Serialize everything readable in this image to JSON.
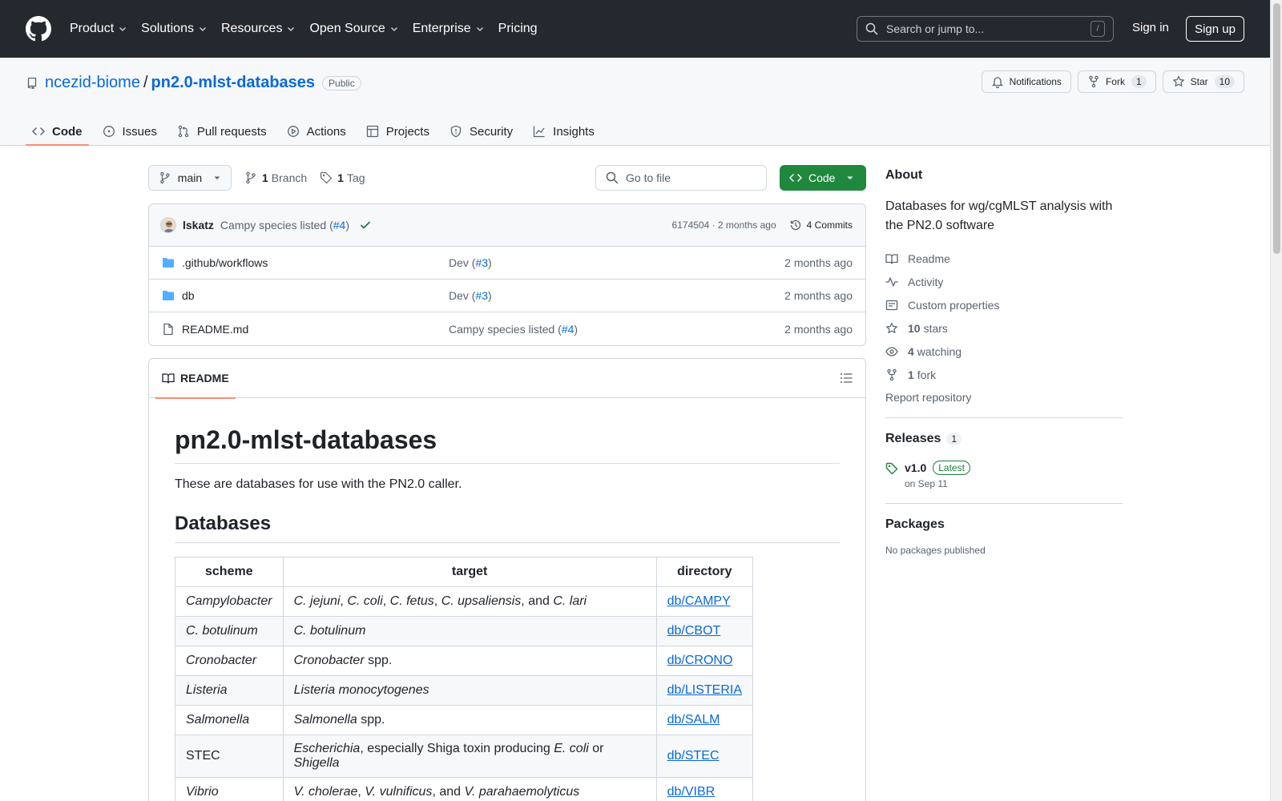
{
  "header": {
    "nav": [
      {
        "label": "Product",
        "dropdown": true
      },
      {
        "label": "Solutions",
        "dropdown": true
      },
      {
        "label": "Resources",
        "dropdown": true
      },
      {
        "label": "Open Source",
        "dropdown": true
      },
      {
        "label": "Enterprise",
        "dropdown": true
      },
      {
        "label": "Pricing",
        "dropdown": false
      }
    ],
    "search_placeholder": "Search or jump to...",
    "search_shortcut": "/",
    "sign_in": "Sign in",
    "sign_up": "Sign up"
  },
  "repo": {
    "owner": "ncezid-biome",
    "separator": "/",
    "name": "pn2.0-mlst-databases",
    "visibility": "Public",
    "notifications_label": "Notifications",
    "fork_label": "Fork",
    "fork_count": "1",
    "star_label": "Star",
    "star_count": "10",
    "tabs": [
      {
        "label": "Code",
        "icon": "code-icon",
        "active": true
      },
      {
        "label": "Issues",
        "icon": "issue-icon",
        "active": false
      },
      {
        "label": "Pull requests",
        "icon": "pull-request-icon",
        "active": false
      },
      {
        "label": "Actions",
        "icon": "play-icon",
        "active": false
      },
      {
        "label": "Projects",
        "icon": "table-icon",
        "active": false
      },
      {
        "label": "Security",
        "icon": "shield-icon",
        "active": false
      },
      {
        "label": "Insights",
        "icon": "graph-icon",
        "active": false
      }
    ]
  },
  "filebar": {
    "branch": "main",
    "branch_count": "1",
    "branch_label": "Branch",
    "tag_count": "1",
    "tag_label": "Tag",
    "goto_placeholder": "Go to file",
    "code_button": "Code"
  },
  "commit": {
    "author": "lskatz",
    "message": "Campy species listed (",
    "pr": "#4",
    "close": ")",
    "sha_time": "6174504 · 2 months ago",
    "commits_label": "4 Commits"
  },
  "files": [
    {
      "name": ".github/workflows",
      "type": "folder",
      "msg": "Dev (",
      "pr": "#3",
      "close": ")",
      "age": "2 months ago"
    },
    {
      "name": "db",
      "type": "folder",
      "msg": "Dev (",
      "pr": "#3",
      "close": ")",
      "age": "2 months ago"
    },
    {
      "name": "README.md",
      "type": "file",
      "msg": "Campy species listed (",
      "pr": "#4",
      "close": ")",
      "age": "2 months ago"
    }
  ],
  "readme": {
    "tab_label": "README",
    "title": "pn2.0-mlst-databases",
    "intro": "These are databases for use with the PN2.0 caller.",
    "section": "Databases",
    "table_headers": [
      "scheme",
      "target",
      "directory"
    ],
    "rows": [
      {
        "scheme": [
          {
            "t": "Campylobacter",
            "i": true
          }
        ],
        "target": [
          {
            "t": "C. jejuni",
            "i": true
          },
          {
            "t": ", ",
            "i": false
          },
          {
            "t": "C. coli",
            "i": true
          },
          {
            "t": ", ",
            "i": false
          },
          {
            "t": "C. fetus",
            "i": true
          },
          {
            "t": ", ",
            "i": false
          },
          {
            "t": "C. upsaliensis",
            "i": true
          },
          {
            "t": ", and ",
            "i": false
          },
          {
            "t": "C. lari",
            "i": true
          }
        ],
        "dir": "db/CAMPY"
      },
      {
        "scheme": [
          {
            "t": "C. botulinum",
            "i": true
          }
        ],
        "target": [
          {
            "t": "C. botulinum",
            "i": true
          }
        ],
        "dir": "db/CBOT"
      },
      {
        "scheme": [
          {
            "t": "Cronobacter",
            "i": true
          }
        ],
        "target": [
          {
            "t": "Cronobacter",
            "i": true
          },
          {
            "t": " spp.",
            "i": false
          }
        ],
        "dir": "db/CRONO"
      },
      {
        "scheme": [
          {
            "t": "Listeria",
            "i": true
          }
        ],
        "target": [
          {
            "t": "Listeria monocytogenes",
            "i": true
          }
        ],
        "dir": "db/LISTERIA"
      },
      {
        "scheme": [
          {
            "t": "Salmonella",
            "i": true
          }
        ],
        "target": [
          {
            "t": "Salmonella",
            "i": true
          },
          {
            "t": " spp.",
            "i": false
          }
        ],
        "dir": "db/SALM"
      },
      {
        "scheme": [
          {
            "t": "STEC",
            "i": false
          }
        ],
        "target": [
          {
            "t": "Escherichia",
            "i": true
          },
          {
            "t": ", especially Shiga toxin producing ",
            "i": false
          },
          {
            "t": "E. coli",
            "i": true
          },
          {
            "t": " or ",
            "i": false
          },
          {
            "t": "Shigella",
            "i": true
          }
        ],
        "dir": "db/STEC"
      },
      {
        "scheme": [
          {
            "t": "Vibrio",
            "i": true
          }
        ],
        "target": [
          {
            "t": "V. cholerae",
            "i": true
          },
          {
            "t": ", ",
            "i": false
          },
          {
            "t": "V. vulnificus",
            "i": true
          },
          {
            "t": ", and ",
            "i": false
          },
          {
            "t": "V. parahaemolyticus",
            "i": true
          }
        ],
        "dir": "db/VIBR"
      }
    ]
  },
  "sidebar": {
    "about_title": "About",
    "description": "Databases for wg/cgMLST analysis with the PN2.0 software",
    "links": [
      {
        "icon": "book-icon",
        "bold": "",
        "label": "Readme"
      },
      {
        "icon": "pulse-icon",
        "bold": "",
        "label": "Activity"
      },
      {
        "icon": "note-icon",
        "bold": "",
        "label": "Custom properties"
      },
      {
        "icon": "star-icon",
        "bold": "10",
        "label": "stars"
      },
      {
        "icon": "eye-icon",
        "bold": "4",
        "label": "watching"
      },
      {
        "icon": "fork-icon",
        "bold": "1",
        "label": "fork"
      }
    ],
    "report": "Report repository",
    "releases_title": "Releases",
    "releases_count": "1",
    "release_name": "v1.0",
    "release_badge": "Latest",
    "release_date": "on Sep 11",
    "packages_title": "Packages",
    "packages_empty": "No packages published"
  }
}
